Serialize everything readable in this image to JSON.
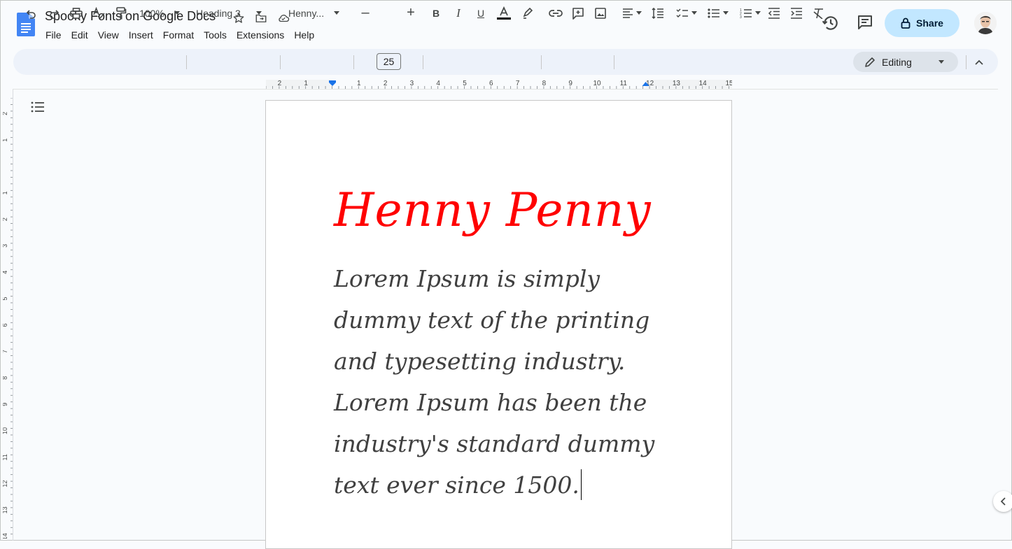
{
  "document": {
    "title": "Spooky Fonts on Google Docs",
    "heading": "Henny Penny",
    "body": "Lorem Ipsum is simply dummy text of the printing and typesetting industry. Lorem Ipsum has been the industry's standard dummy text ever since 1500.",
    "heading_color": "#ff0000",
    "body_color": "#404040"
  },
  "menu": [
    "File",
    "Edit",
    "View",
    "Insert",
    "Format",
    "Tools",
    "Extensions",
    "Help"
  ],
  "share": {
    "label": "Share",
    "color": "#c2e7ff"
  },
  "toolbar": {
    "zoom": "100%",
    "style": "Heading 3",
    "font": "Henny...",
    "font_size": "25",
    "mode": "Editing"
  },
  "ruler": {
    "horizontal_ticks": [
      "2",
      "1",
      "1",
      "2",
      "3",
      "4",
      "5",
      "6",
      "7",
      "8",
      "9",
      "10",
      "11",
      "12",
      "13",
      "14",
      "15"
    ],
    "vertical_ticks": [
      "2",
      "1",
      "1",
      "2",
      "3",
      "4",
      "5",
      "6",
      "7",
      "8",
      "9",
      "10",
      "11",
      "12",
      "13",
      "14"
    ]
  },
  "icons": {
    "docs_logo": "docs-logo-icon",
    "star": "star-icon",
    "move": "folder-move-icon",
    "cloud": "cloud-saved-icon",
    "history": "version-history-icon",
    "comments": "comments-icon",
    "lock": "lock-icon",
    "outline": "document-outline-icon"
  }
}
